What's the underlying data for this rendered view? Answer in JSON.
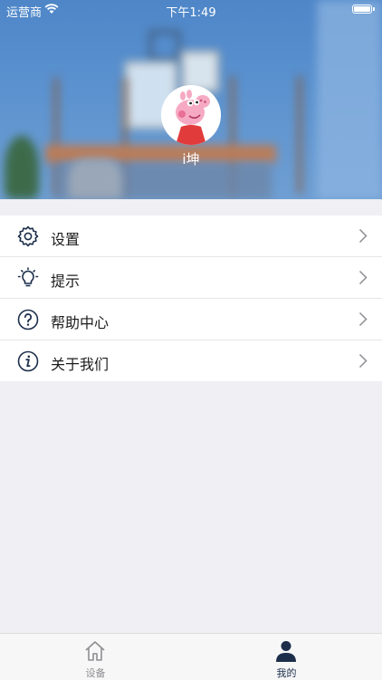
{
  "status_bar": {
    "carrier": "运营商",
    "time": "下午1:49",
    "battery_level": 1.0
  },
  "profile": {
    "username": "i坤"
  },
  "menu": {
    "items": [
      {
        "label": "设置",
        "icon": "gear-icon"
      },
      {
        "label": "提示",
        "icon": "lightbulb-icon"
      },
      {
        "label": "帮助中心",
        "icon": "help-circle-icon"
      },
      {
        "label": "关于我们",
        "icon": "info-circle-icon"
      }
    ]
  },
  "tabbar": {
    "tabs": [
      {
        "label": "设备",
        "icon": "home-icon",
        "selected": false
      },
      {
        "label": "我的",
        "icon": "person-icon",
        "selected": true
      }
    ]
  },
  "colors": {
    "accent": "#1c2e4a",
    "inactive": "#8e8e93",
    "header_blue": "#5b92cf"
  }
}
